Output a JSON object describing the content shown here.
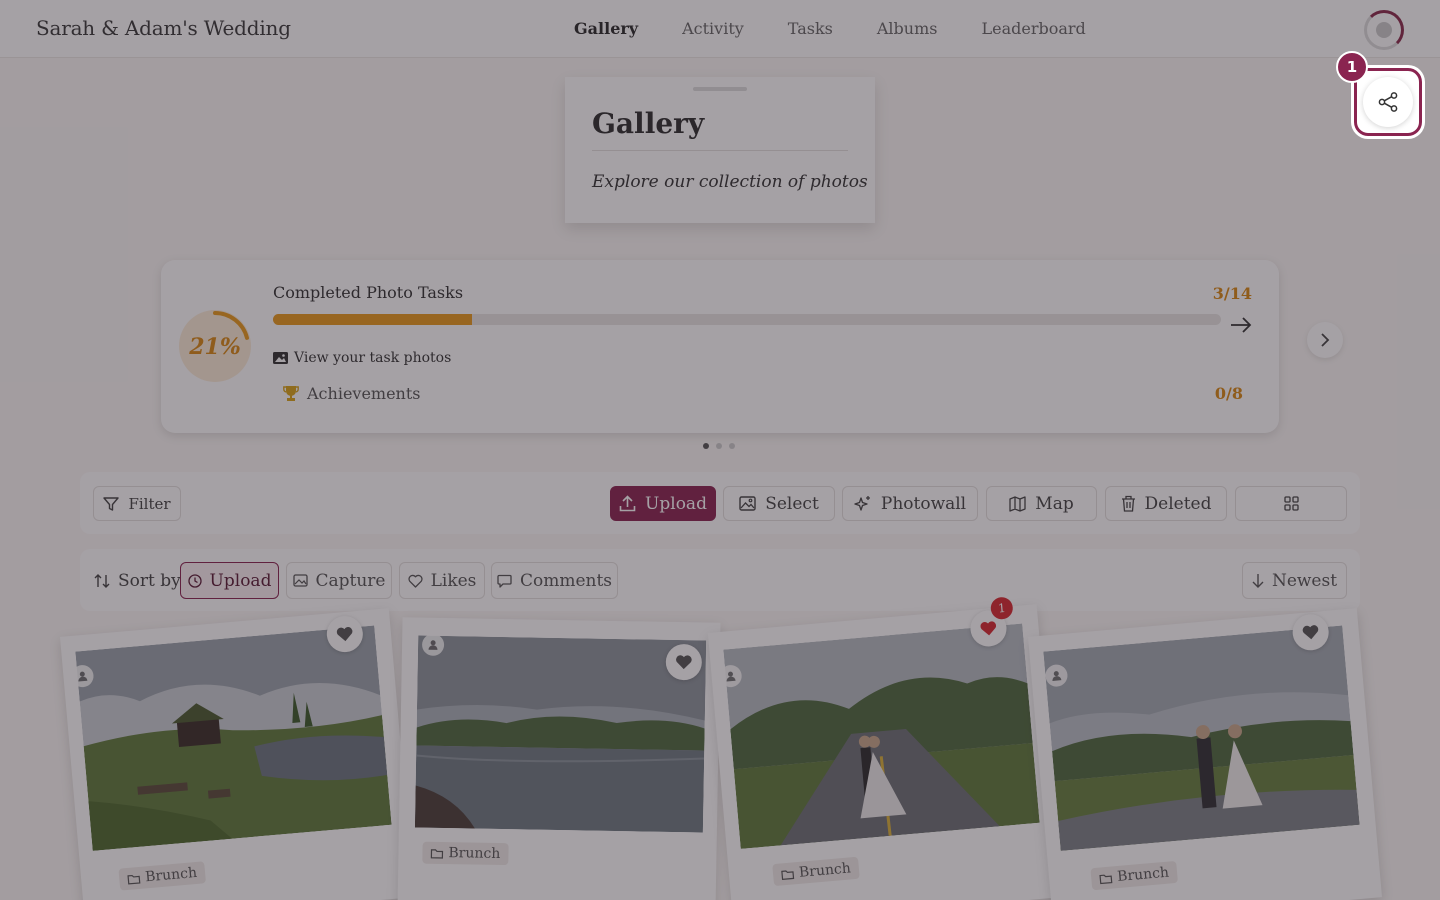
{
  "header": {
    "brand": "Sarah & Adam's Wedding",
    "nav": [
      "Gallery",
      "Activity",
      "Tasks",
      "Albums",
      "Leaderboard"
    ],
    "active_nav": "Gallery"
  },
  "title_card": {
    "title": "Gallery",
    "subtitle": "Explore our collection of photos"
  },
  "progress": {
    "percent_label": "21%",
    "percent": 21,
    "title": "Completed Photo Tasks",
    "count": "3/14",
    "link_label": "View your task photos",
    "achievements_label": "Achievements",
    "achievements_count": "0/8",
    "accent": "#d98814"
  },
  "carousel": {
    "pages": 3,
    "current": 1
  },
  "toolbar": {
    "filter": "Filter",
    "upload": "Upload",
    "select": "Select",
    "photowall": "Photowall",
    "map": "Map",
    "deleted": "Deleted"
  },
  "sort": {
    "label": "Sort by",
    "options": [
      "Upload",
      "Capture",
      "Likes",
      "Comments"
    ],
    "active": "Upload",
    "order": "Newest"
  },
  "photos": [
    {
      "tag": "Brunch",
      "liked": false,
      "likes": ""
    },
    {
      "tag": "Brunch",
      "liked": false,
      "likes": ""
    },
    {
      "tag": "Brunch",
      "liked": true,
      "likes": "1"
    },
    {
      "tag": "Brunch",
      "liked": false,
      "likes": ""
    }
  ],
  "tour": {
    "step": "1",
    "target": "share-icon"
  },
  "colors": {
    "brand": "#8a2450",
    "accent": "#e89a1c",
    "like": "#d7282f"
  }
}
